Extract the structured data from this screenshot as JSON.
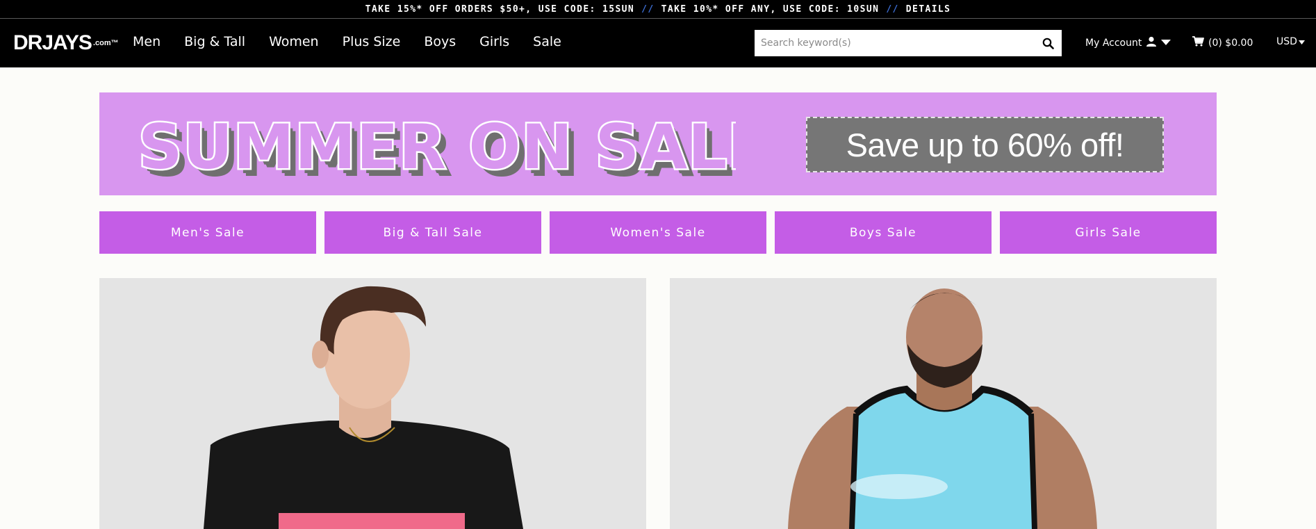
{
  "promo": {
    "offer1": "TAKE 15%* OFF ORDERS $50+, USE CODE: 15SUN",
    "separator": "//",
    "offer2": "TAKE 10%* OFF ANY, USE CODE: 10SUN",
    "details": "DETAILS"
  },
  "header": {
    "logo": "DRJAYS",
    "logo_suffix": ".com™",
    "nav": [
      "Men",
      "Big & Tall",
      "Women",
      "Plus Size",
      "Boys",
      "Girls",
      "Sale"
    ],
    "search_placeholder": "Search keyword(s)",
    "account_label": "My Account",
    "cart_label": "(0) $0.00",
    "currency": "USD"
  },
  "hero": {
    "headline": "SUMMER ON SALE!",
    "offer": "Save up to 60% off!"
  },
  "categories": [
    "Men's Sale",
    "Big & Tall Sale",
    "Women's Sale",
    "Boys Sale",
    "Girls Sale"
  ],
  "colors": {
    "promo_bg": "#000000",
    "hero_bg": "#d896ef",
    "category_bg": "#c45de6",
    "offer_box": "#767676"
  },
  "icons": [
    "search-icon",
    "user-icon",
    "caret-down-icon",
    "cart-icon"
  ]
}
